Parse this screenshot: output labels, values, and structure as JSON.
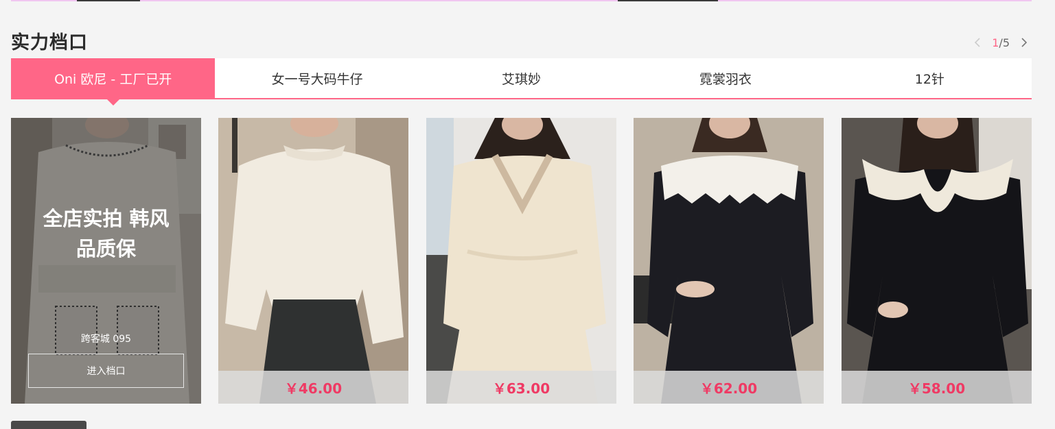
{
  "section": {
    "title": "实力档口"
  },
  "pager": {
    "current": "1",
    "separator_total": "/5",
    "prev_icon": "chevron-left-icon",
    "next_icon": "chevron-right-icon"
  },
  "tabs": [
    {
      "label": "Oni 欧尼 - 工厂已开",
      "active": true
    },
    {
      "label": "女一号大码牛仔",
      "active": false
    },
    {
      "label": "艾琪妙",
      "active": false
    },
    {
      "label": "霓裳羽衣",
      "active": false
    },
    {
      "label": "12针",
      "active": false
    }
  ],
  "shop_card": {
    "slogan": "全店实拍 韩风 品质保",
    "name": "跨客城 095",
    "enter_label": "进入档口"
  },
  "products": [
    {
      "price": "￥46.00",
      "garment_color": "#f1ebe0",
      "bg_color": "#c7b9a7"
    },
    {
      "price": "￥63.00",
      "garment_color": "#efe4cf",
      "bg_color": "#e8e6e3"
    },
    {
      "price": "￥62.00",
      "garment_color": "#1c1c22",
      "bg_color": "#bdb2a3"
    },
    {
      "price": "￥58.00",
      "garment_color": "#141418",
      "bg_color": "#5a5550"
    }
  ],
  "colors": {
    "accent": "#ff6687",
    "price": "#ef3a64",
    "page_bg": "#f4f4f4"
  }
}
